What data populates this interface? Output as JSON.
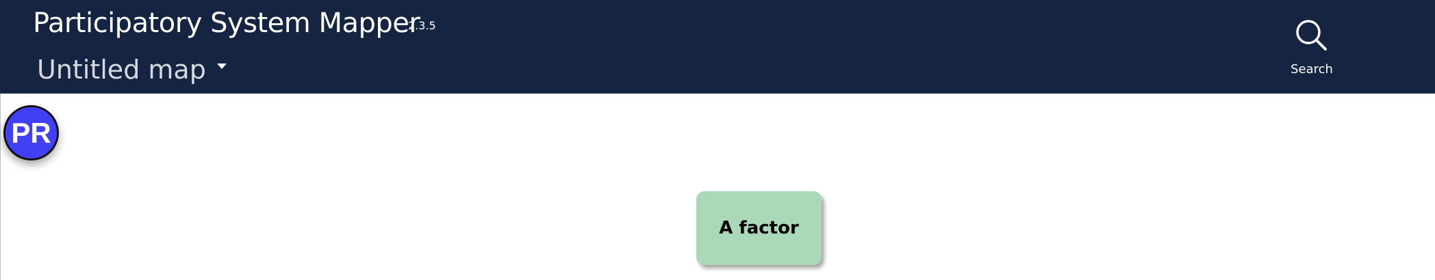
{
  "header": {
    "app_title": "Participatory System Mapper",
    "version": "2.3.5",
    "map_title": "Untitled map",
    "map_title_menu_icon": "caret-down-icon",
    "search": {
      "label": "Search",
      "icon": "search-icon"
    }
  },
  "canvas": {
    "avatar": {
      "initials": "PR",
      "color": "#4240f4"
    },
    "nodes": [
      {
        "label": "A factor",
        "color": "#a9d9b7"
      }
    ]
  },
  "colors": {
    "header_background": "#152441",
    "canvas_background": "#ffffff"
  }
}
